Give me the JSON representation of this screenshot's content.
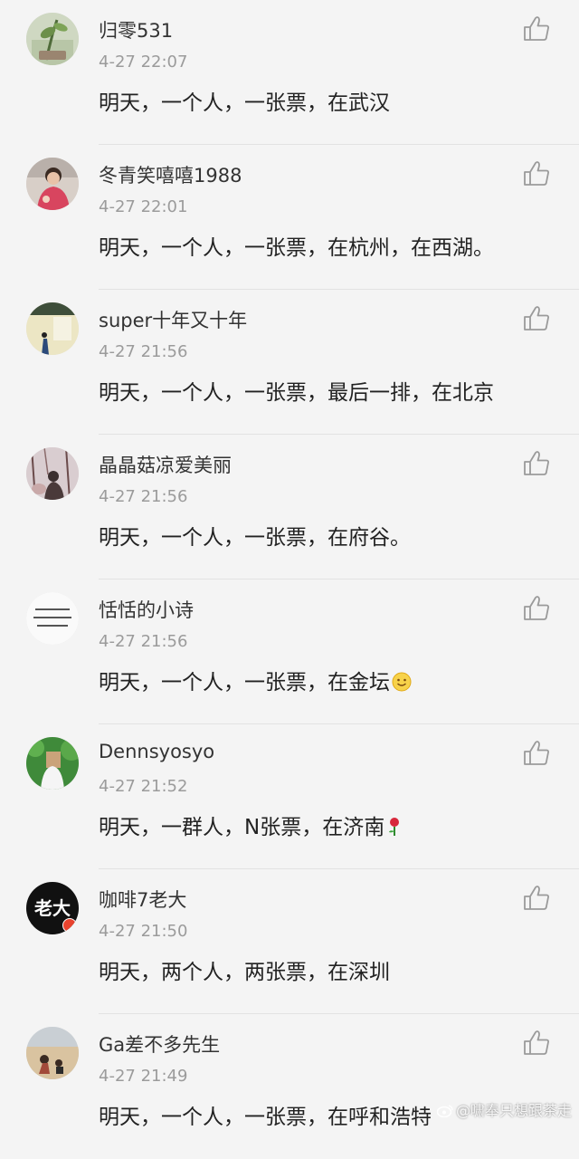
{
  "comments": [
    {
      "name": "归零531",
      "time": "4-27 22:07",
      "text": "明天，一个人，一张票，在武汉",
      "avatar": "avatar-plant"
    },
    {
      "name": "冬青笑嘻嘻1988",
      "time": "4-27 22:01",
      "text": "明天，一个人，一张票，在杭州，在西湖。",
      "avatar": "avatar-person-red"
    },
    {
      "name": "super十年又十年",
      "time": "4-27 21:56",
      "text": "明天，一个人，一张票，最后一排，在北京",
      "avatar": "avatar-figure"
    },
    {
      "name": "晶晶菇凉爱美丽",
      "time": "4-27 21:56",
      "text": "明天，一个人，一张票，在府谷。",
      "avatar": "avatar-trees"
    },
    {
      "name": "恬恬的小诗",
      "time": "4-27 21:56",
      "text": "明天，一个人，一张票，在金坛",
      "avatar": "avatar-text-card",
      "emoji": "smile-emoji"
    },
    {
      "name": "Dennsyosyo",
      "time": "4-27 21:52",
      "text": "明天，一群人，N张票，在济南",
      "avatar": "avatar-green",
      "emoji": "rose-emoji"
    },
    {
      "name": "咖啡7老大",
      "time": "4-27 21:50",
      "text": "明天，两个人，两张票，在深圳",
      "avatar": "avatar-laoda",
      "avatar_text": "老大"
    },
    {
      "name": "Ga差不多先生",
      "time": "4-27 21:49",
      "text": "明天，一个人，一张票，在呼和浩特",
      "avatar": "avatar-beach"
    }
  ],
  "like_icon": "thumbs-up-icon",
  "colors": {
    "background": "#f4f4f4",
    "name": "#333333",
    "time": "#9b9b9b",
    "text": "#222222"
  }
}
